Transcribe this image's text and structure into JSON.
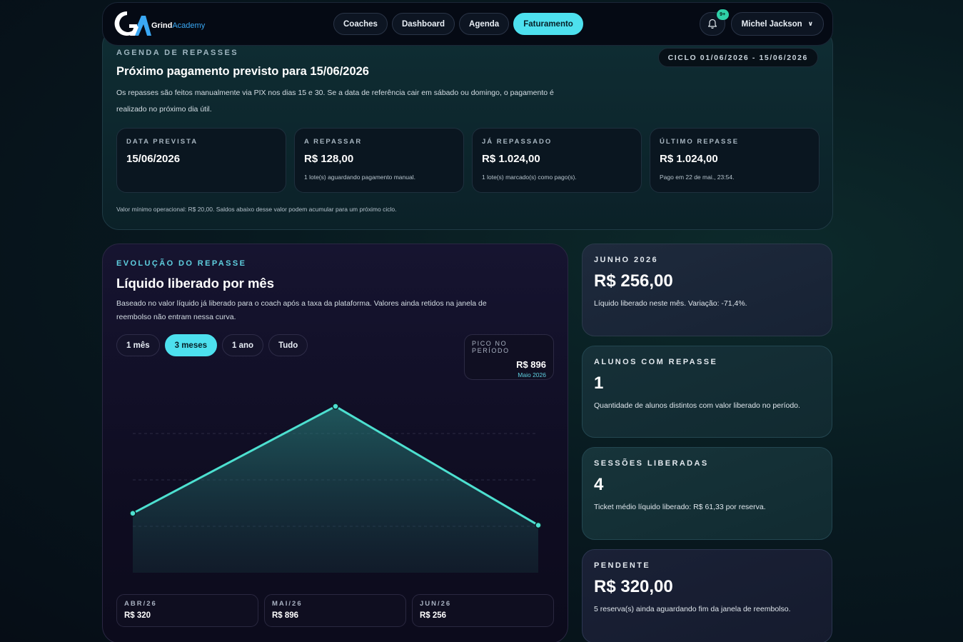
{
  "brand": {
    "name_main": "Grind",
    "name_accent": "Academy",
    "accent_color": "#3aa8f4"
  },
  "nav": {
    "links": [
      {
        "label": "Coaches",
        "active": false
      },
      {
        "label": "Dashboard",
        "active": false
      },
      {
        "label": "Agenda",
        "active": false
      },
      {
        "label": "Faturamento",
        "active": true
      }
    ],
    "notification_badge": "9+",
    "user_name": "Michel Jackson"
  },
  "agenda": {
    "eyebrow": "AGENDA DE REPASSES",
    "cycle": "CICLO 01/06/2026 - 15/06/2026",
    "title": "Próximo pagamento previsto para 15/06/2026",
    "description": "Os repasses são feitos manualmente via PIX nos dias 15 e 30. Se a data de referência cair em sábado ou domingo, o pagamento é realizado no próximo dia útil.",
    "stats": [
      {
        "label": "DATA PREVISTA",
        "value": "15/06/2026",
        "note": ""
      },
      {
        "label": "A REPASSAR",
        "value": "R$ 128,00",
        "note": "1 lote(s) aguardando pagamento manual."
      },
      {
        "label": "JÁ REPASSADO",
        "value": "R$ 1.024,00",
        "note": "1 lote(s) marcado(s) como pago(s)."
      },
      {
        "label": "ÚLTIMO REPASSE",
        "value": "R$ 1.024,00",
        "note": "Pago em 22 de mai., 23:54."
      }
    ],
    "footer": "Valor mínimo operacional: R$ 20,00. Saldos abaixo desse valor podem acumular para um próximo ciclo."
  },
  "evolution": {
    "eyebrow": "EVOLUÇÃO DO REPASSE",
    "title": "Líquido liberado por mês",
    "description": "Baseado no valor líquido já liberado para o coach após a taxa da plataforma. Valores ainda retidos na janela de reembolso não entram nessa curva.",
    "ranges": [
      {
        "label": "1 mês",
        "active": false
      },
      {
        "label": "3 meses",
        "active": true
      },
      {
        "label": "1 ano",
        "active": false
      },
      {
        "label": "Tudo",
        "active": false
      }
    ],
    "peak": {
      "label": "PICO NO PERÍODO",
      "value": "R$ 896",
      "month": "Maio 2026"
    },
    "months": [
      {
        "label": "ABR/26",
        "value": "R$ 320"
      },
      {
        "label": "MAI/26",
        "value": "R$ 896"
      },
      {
        "label": "JUN/26",
        "value": "R$ 256"
      }
    ]
  },
  "chart_data": {
    "type": "area",
    "x": [
      "ABR/26",
      "MAI/26",
      "JUN/26"
    ],
    "series": [
      {
        "values": [
          320,
          896,
          256
        ]
      }
    ],
    "ylim": [
      0,
      1000
    ],
    "grid": true,
    "line_color": "#4de0d0"
  },
  "side_cards": [
    {
      "eyebrow": "JUNHO 2026",
      "value": "R$ 256,00",
      "note": "Líquido liberado neste mês. Variação: -71,4%."
    },
    {
      "eyebrow": "ALUNOS COM REPASSE",
      "value": "1",
      "note": "Quantidade de alunos distintos com valor liberado no período."
    },
    {
      "eyebrow": "SESSÕES LIBERADAS",
      "value": "4",
      "note": "Ticket médio líquido liberado: R$ 61,33 por reserva."
    },
    {
      "eyebrow": "PENDENTE",
      "value": "R$ 320,00",
      "note": "5 reserva(s) ainda aguardando fim da janela de reembolso."
    }
  ]
}
